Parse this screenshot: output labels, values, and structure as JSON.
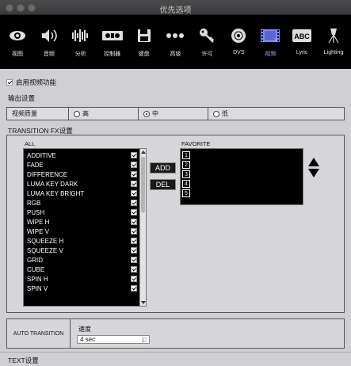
{
  "window": {
    "title": "优先选项"
  },
  "toolbar": {
    "items": [
      {
        "id": "view",
        "label": "视图",
        "icon": "eye-icon"
      },
      {
        "id": "audio",
        "label": "音频",
        "icon": "speaker-icon"
      },
      {
        "id": "analysis",
        "label": "分析",
        "icon": "waveform-icon"
      },
      {
        "id": "controller",
        "label": "控制器",
        "icon": "controller-icon"
      },
      {
        "id": "keyboard",
        "label": "键盘",
        "icon": "floppy-icon"
      },
      {
        "id": "advanced",
        "label": "高级",
        "icon": "dots-icon"
      },
      {
        "id": "license",
        "label": "许可",
        "icon": "key-icon"
      },
      {
        "id": "dvs",
        "label": "DVS",
        "icon": "disc-icon"
      },
      {
        "id": "video",
        "label": "视频",
        "icon": "video-icon"
      },
      {
        "id": "lyric",
        "label": "Lyric",
        "icon": "abc-icon"
      },
      {
        "id": "lighting",
        "label": "Lighting",
        "icon": "lighting-icon"
      }
    ],
    "active": "video"
  },
  "enable_video": {
    "label": "启用视频功能",
    "checked": true
  },
  "output": {
    "section_label": "输出设置",
    "quality_label": "视频质量",
    "options": [
      {
        "label": "高",
        "selected": false
      },
      {
        "label": "中",
        "selected": true
      },
      {
        "label": "低",
        "selected": false
      }
    ]
  },
  "transition": {
    "section_label": "TRANSITION FX设置",
    "all_label": "ALL",
    "favorite_label": "FAVORITE",
    "add_label": "ADD",
    "del_label": "DEL",
    "all_items": [
      "ADDITIVE",
      "FADE",
      "DIFFERENCE",
      "LUMA KEY DARK",
      "LUMA KEY BRIGHT",
      "RGB",
      "PUSH",
      "WIPE H",
      "WIPE V",
      "SQUEEZE H",
      "SQUEEZE V",
      "GRID",
      "CUBE",
      "SPIN H",
      "SPIN V"
    ],
    "favorite_slots": [
      "1",
      "2",
      "3",
      "4",
      "5"
    ]
  },
  "auto_transition": {
    "label": "AUTO TRANSITION",
    "speed_label": "速度",
    "speed_value": "4 sec"
  },
  "text_settings": {
    "label": "TEXT设置"
  }
}
